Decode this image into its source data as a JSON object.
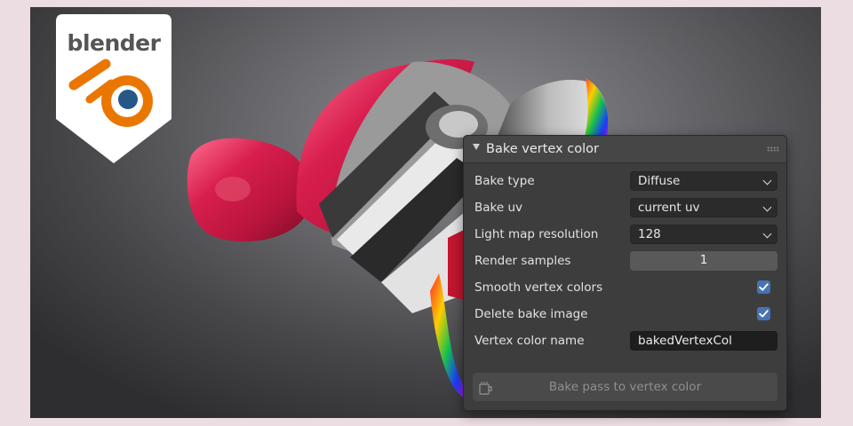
{
  "logo": {
    "text": "blender",
    "icon": "blender-logo-icon"
  },
  "panel": {
    "title": "Bake vertex color",
    "collapse_icon": "triangle-down-icon",
    "rows": {
      "bake_type": {
        "label": "Bake type",
        "value": "Diffuse"
      },
      "bake_uv": {
        "label": "Bake uv",
        "value": "current uv"
      },
      "light_map_resolution": {
        "label": "Light map resolution",
        "value": "128"
      },
      "render_samples": {
        "label": "Render samples",
        "value": "1"
      },
      "smooth_vertex_colors": {
        "label": "Smooth vertex colors",
        "checked": true
      },
      "delete_bake_image": {
        "label": "Delete bake image",
        "checked": true
      },
      "vertex_color_name": {
        "label": "Vertex color name",
        "value": "bakedVertexCol"
      }
    },
    "bake_button": {
      "label": "Bake pass to vertex color",
      "icon": "bake-icon"
    }
  },
  "colors": {
    "accent": "#4772b3",
    "panel_bg": "#3d3d3d",
    "logo_orange": "#ea7600",
    "logo_blue": "#265787"
  }
}
